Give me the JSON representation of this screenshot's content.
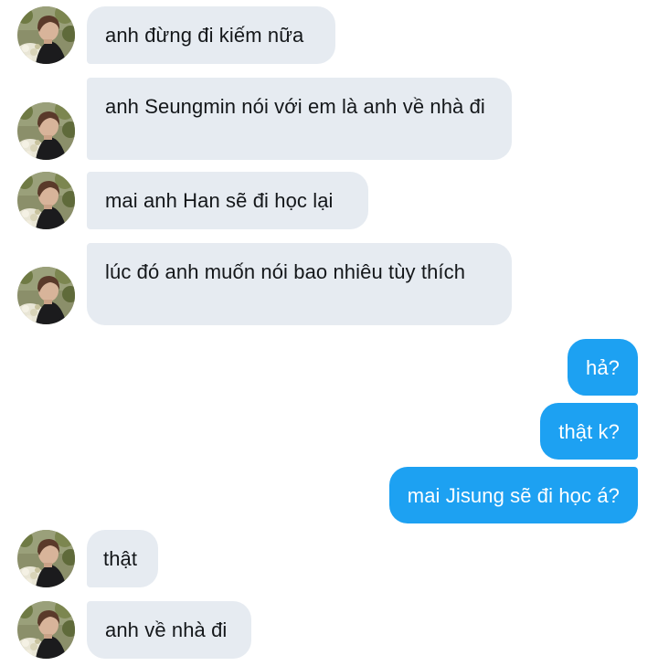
{
  "conversation": {
    "messages": [
      {
        "direction": "incoming",
        "text": "anh đừng đi kiếm nữa"
      },
      {
        "direction": "incoming",
        "text": "anh Seungmin nói với em là anh về nhà đi"
      },
      {
        "direction": "incoming",
        "text": "mai anh Han sẽ đi học lại"
      },
      {
        "direction": "incoming",
        "text": "lúc đó anh muốn nói bao nhiêu tùy thích"
      },
      {
        "direction": "outgoing",
        "text": "hả?"
      },
      {
        "direction": "outgoing",
        "text": "thật k?"
      },
      {
        "direction": "outgoing",
        "text": "mai Jisung sẽ đi học á?"
      },
      {
        "direction": "incoming",
        "text": "thật"
      },
      {
        "direction": "incoming",
        "text": "anh về nhà đi"
      }
    ]
  },
  "colors": {
    "incoming_bubble": "#e6ebf1",
    "outgoing_bubble": "#1da1f2",
    "incoming_text": "#14171a",
    "outgoing_text": "#ffffff"
  },
  "icons": {
    "avatar": "contact-avatar-photo"
  }
}
